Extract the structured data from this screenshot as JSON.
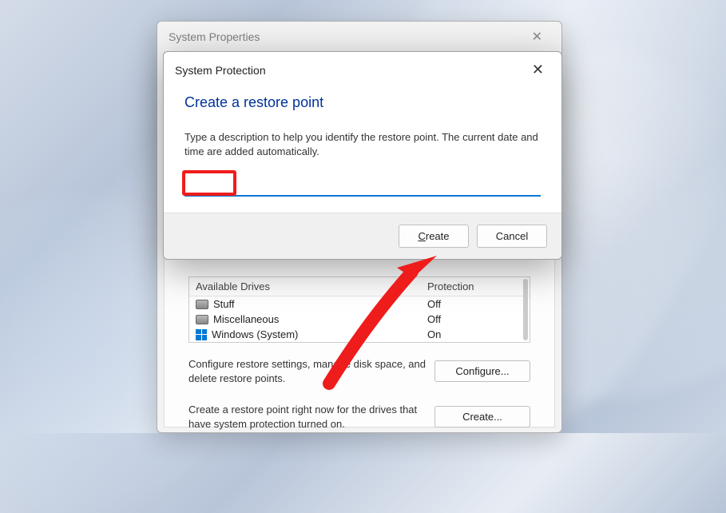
{
  "parent": {
    "title": "System Properties",
    "drives_header_col1": "Available Drives",
    "drives_header_col2": "Protection",
    "drives": [
      {
        "name": "Stuff",
        "protection": "Off",
        "icon": "disk"
      },
      {
        "name": "Miscellaneous",
        "protection": "Off",
        "icon": "disk"
      },
      {
        "name": "Windows (System)",
        "protection": "On",
        "icon": "windows"
      }
    ],
    "configure_text": "Configure restore settings, manage disk space, and delete restore points.",
    "configure_button": "Configure...",
    "create_text": "Create a restore point right now for the drives that have system protection turned on.",
    "create_button": "Create..."
  },
  "modal": {
    "title": "System Protection",
    "heading": "Create a restore point",
    "description": "Type a description to help you identify the restore point. The current date and time are added automatically.",
    "input_value": "",
    "create_label": "Create",
    "cancel_label": "Cancel"
  }
}
